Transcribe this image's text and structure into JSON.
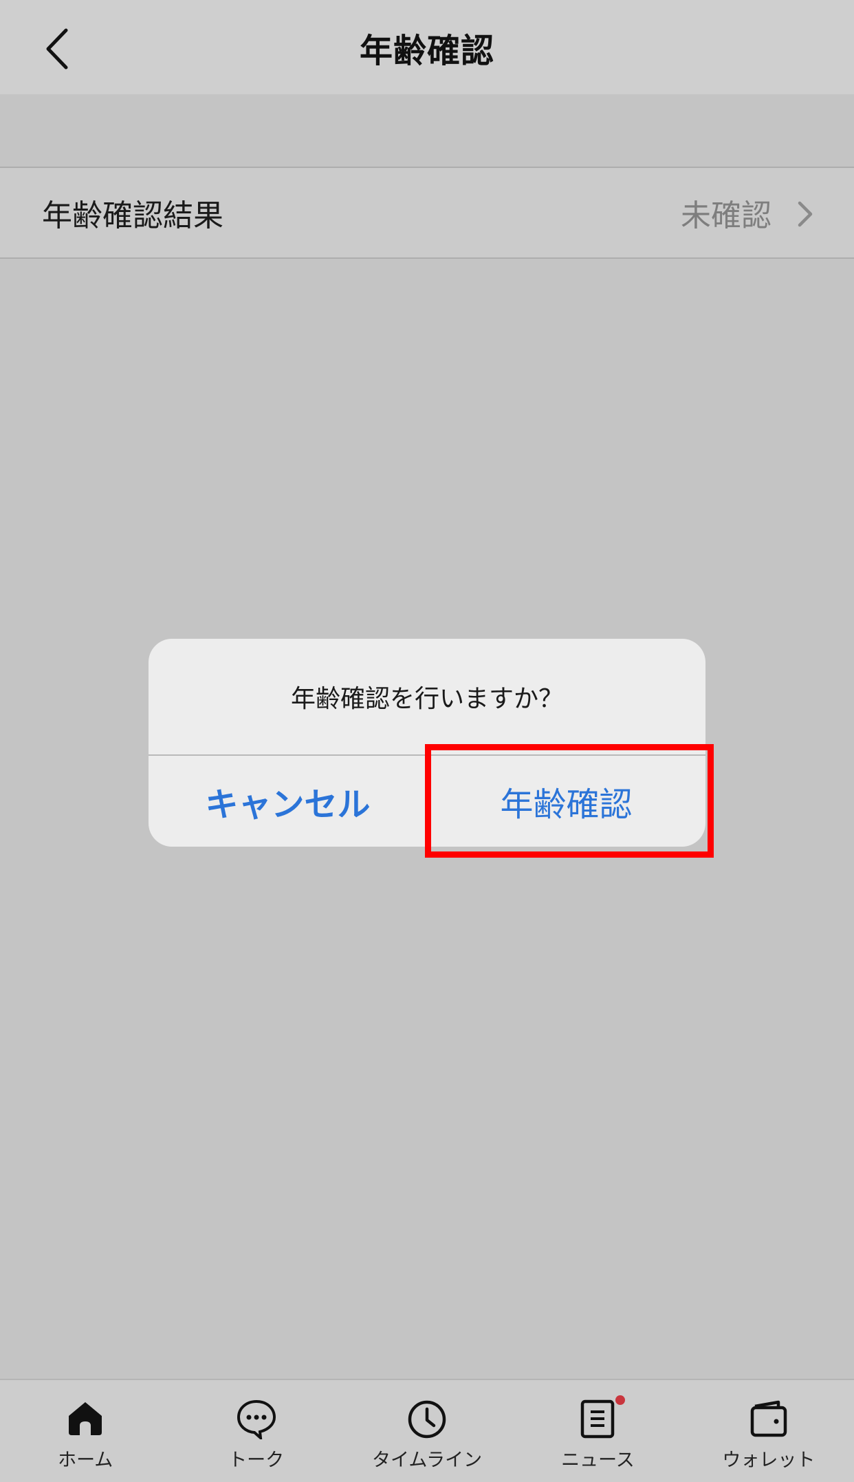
{
  "header": {
    "title": "年齢確認",
    "back_icon": "chevron-left-icon"
  },
  "row": {
    "label": "年齢確認結果",
    "value": "未確認",
    "chevron_icon": "chevron-right-icon"
  },
  "dialog": {
    "message": "年齢確認を行いますか？",
    "cancel_label": "キャンセル",
    "confirm_label": "年齢確認"
  },
  "tabbar": {
    "items": [
      {
        "label": "ホーム",
        "icon": "home-icon"
      },
      {
        "label": "トーク",
        "icon": "chat-bubble-icon"
      },
      {
        "label": "タイムライン",
        "icon": "clock-icon"
      },
      {
        "label": "ニュース",
        "icon": "news-icon",
        "badge": true
      },
      {
        "label": "ウォレット",
        "icon": "wallet-icon"
      }
    ]
  },
  "colors": {
    "accent": "#2b74d8",
    "highlight": "#ff0000",
    "badge": "#c9363e"
  }
}
